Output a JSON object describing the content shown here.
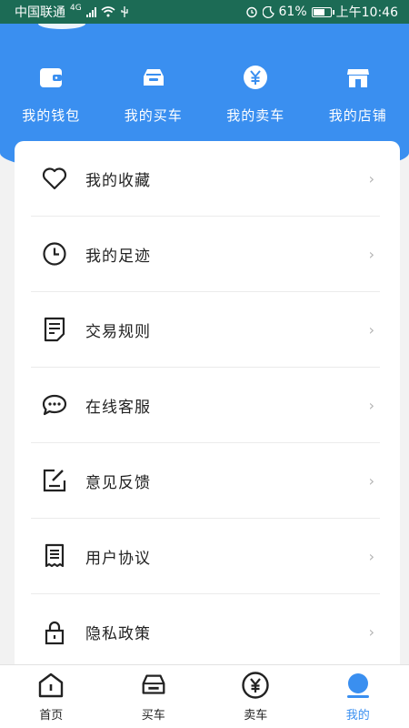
{
  "status_bar": {
    "carrier": "中国联通",
    "network": "4G",
    "battery": "61%",
    "time": "上午10:46"
  },
  "quick_nav": [
    {
      "label": "我的钱包",
      "icon": "wallet-icon"
    },
    {
      "label": "我的买车",
      "icon": "car-buy-icon"
    },
    {
      "label": "我的卖车",
      "icon": "yen-icon"
    },
    {
      "label": "我的店铺",
      "icon": "store-icon"
    }
  ],
  "menu": [
    {
      "label": "我的收藏",
      "icon": "heart-icon"
    },
    {
      "label": "我的足迹",
      "icon": "clock-icon"
    },
    {
      "label": "交易规则",
      "icon": "document-icon"
    },
    {
      "label": "在线客服",
      "icon": "chat-icon"
    },
    {
      "label": "意见反馈",
      "icon": "edit-icon"
    },
    {
      "label": "用户协议",
      "icon": "receipt-icon"
    },
    {
      "label": "隐私政策",
      "icon": "lock-icon"
    }
  ],
  "tabs": [
    {
      "label": "首页",
      "icon": "home-icon",
      "active": false
    },
    {
      "label": "买车",
      "icon": "car-icon",
      "active": false
    },
    {
      "label": "卖车",
      "icon": "yen-circle-icon",
      "active": false
    },
    {
      "label": "我的",
      "icon": "profile-icon",
      "active": true
    }
  ],
  "colors": {
    "accent": "#3a8ff0",
    "status_bar": "#1c6b55"
  }
}
